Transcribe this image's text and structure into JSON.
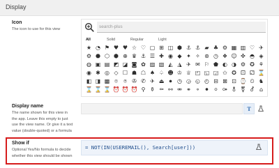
{
  "section": {
    "title": "Display"
  },
  "icon_setting": {
    "label": "Icon",
    "description": "The icon to use for this view",
    "search": {
      "placeholder": "search-plus"
    },
    "filters": [
      "All",
      "Solid",
      "Regular",
      "Light"
    ],
    "icons": [
      "★",
      "◔",
      "⚑",
      "♥",
      "♥",
      "☆",
      "♡",
      "▢",
      "⊞",
      "◫",
      "⬢",
      "⚓",
      "⚓",
      "▰",
      "♣",
      "⚙",
      "▦",
      "▥",
      "♡",
      "✈",
      "⚙",
      "⬣",
      "⬡",
      "⬢",
      "⊕",
      "♛",
      "⚓",
      "☰",
      "✚",
      "◉",
      "◆",
      "✦",
      "✧",
      "⊛",
      "◷",
      "❖",
      "☺",
      "✜",
      "◓",
      "◈",
      "◍",
      "▣",
      "▤",
      "◩",
      "◪",
      "◙",
      "✿",
      "▨",
      "▧",
      "◭",
      "◮",
      "✈",
      "✉",
      "⚐",
      "⬟",
      "◐",
      "◑",
      "⚙",
      "✪",
      "⚘",
      "◉",
      "✱",
      "◎",
      "◇",
      "☐",
      "☗",
      "☖",
      "♠",
      "♤",
      "☻",
      "♔",
      "♕",
      "◰",
      "◱",
      "◲",
      "✩",
      "✪",
      "⚀",
      "⚁",
      "⌛",
      "◧",
      "◨",
      "▩",
      "⌾",
      "⍟",
      "✇",
      "✆",
      "✈",
      "⏏",
      "⏺",
      "◷",
      "◶",
      "◵",
      "◴",
      "⊟",
      "⊠",
      "⊡",
      "⌚",
      "⏲",
      "♞",
      "⌛",
      "⌛",
      "⌛",
      "⏰",
      "⏰",
      "⏰",
      "⚲",
      "⚱",
      "⚰",
      "⚯",
      "⚮",
      "⚭",
      "⚬",
      "⚫",
      "⚪",
      "⚩",
      "⚨",
      "⚧",
      "⚦",
      "⌂"
    ]
  },
  "display_name": {
    "label": "Display name",
    "description": [
      "The name shown for this view in",
      "the app. Leave this empty to just",
      "use the view name. Or give it a text",
      "value (double-quoted) or a formula"
    ],
    "value": "",
    "text_mode_label": "T"
  },
  "show_if": {
    "label": "Show if",
    "description": [
      "Optional Yes/No formula to decide",
      "whether this view should be shown"
    ],
    "formula": "= NOT(IN(USEREMAIL(), Search[user]))"
  }
}
